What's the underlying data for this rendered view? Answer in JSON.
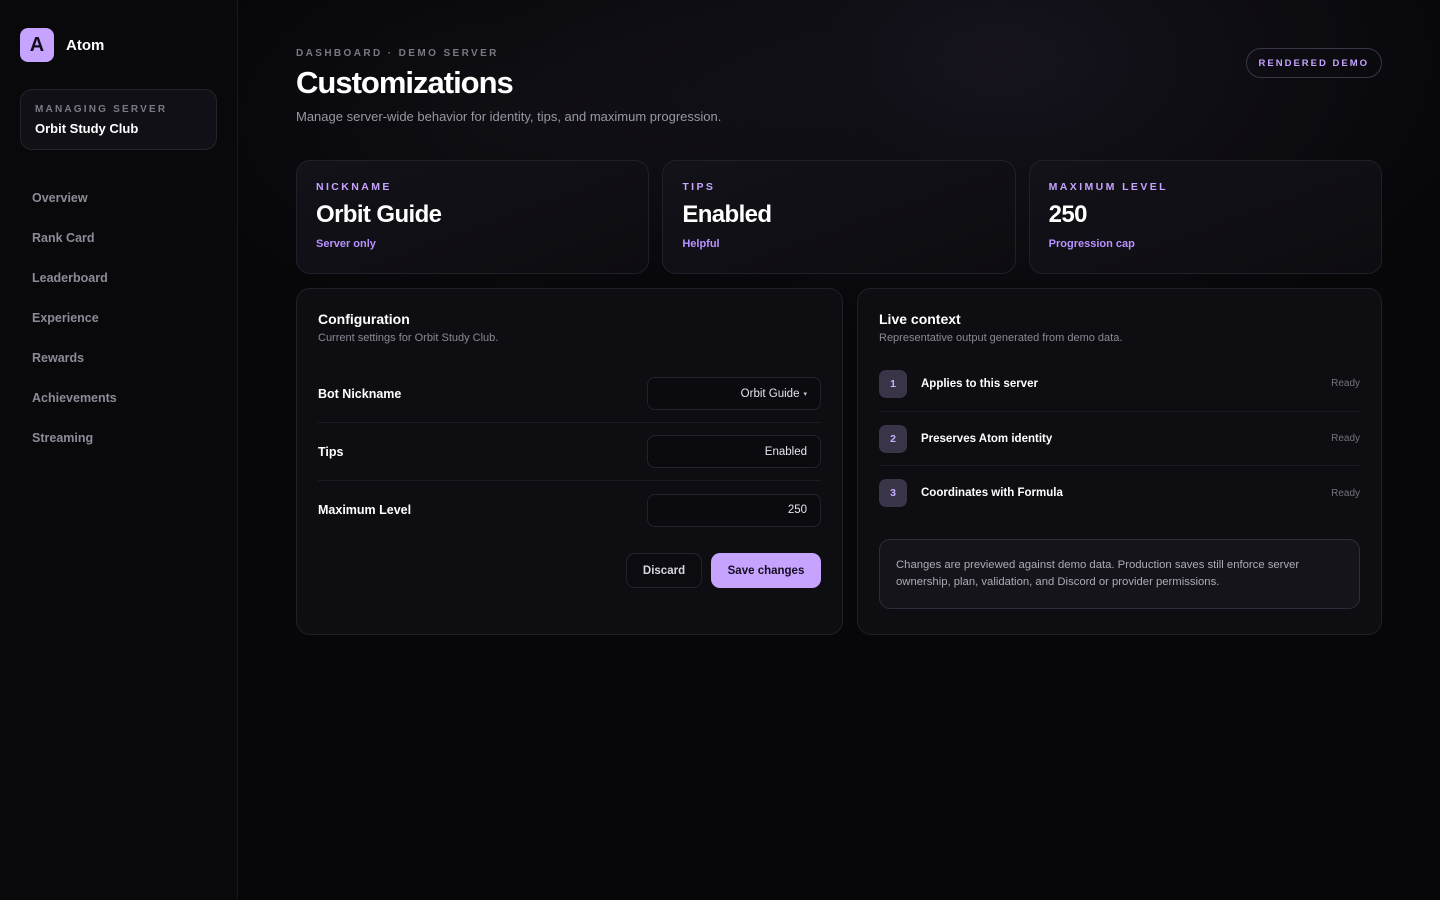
{
  "brand": {
    "logo_letter": "A",
    "name": "Atom"
  },
  "server": {
    "kicker": "MANAGING SERVER",
    "name": "Orbit Study Club"
  },
  "nav": {
    "items": [
      {
        "label": "Overview"
      },
      {
        "label": "Rank Card"
      },
      {
        "label": "Leaderboard"
      },
      {
        "label": "Experience"
      },
      {
        "label": "Rewards"
      },
      {
        "label": "Achievements"
      },
      {
        "label": "Streaming"
      }
    ]
  },
  "header": {
    "breadcrumb": "DASHBOARD · DEMO SERVER",
    "title": "Customizations",
    "subtitle": "Manage server-wide behavior for identity, tips, and maximum progression.",
    "badge": "RENDERED DEMO"
  },
  "stats": [
    {
      "kicker": "NICKNAME",
      "value": "Orbit Guide",
      "note": "Server only"
    },
    {
      "kicker": "TIPS",
      "value": "Enabled",
      "note": "Helpful"
    },
    {
      "kicker": "MAXIMUM LEVEL",
      "value": "250",
      "note": "Progression cap"
    }
  ],
  "config": {
    "title": "Configuration",
    "subtitle": "Current settings for Orbit Study Club.",
    "fields": [
      {
        "label": "Bot Nickname",
        "value": "Orbit Guide",
        "caret": "▾"
      },
      {
        "label": "Tips",
        "value": "Enabled"
      },
      {
        "label": "Maximum Level",
        "value": "250"
      }
    ],
    "discard_label": "Discard",
    "save_label": "Save changes"
  },
  "live": {
    "title": "Live context",
    "subtitle": "Representative output generated from demo data.",
    "items": [
      {
        "num": "1",
        "label": "Applies to this server",
        "status": "Ready"
      },
      {
        "num": "2",
        "label": "Preserves Atom identity",
        "status": "Ready"
      },
      {
        "num": "3",
        "label": "Coordinates with Formula",
        "status": "Ready"
      }
    ],
    "notice": "Changes are previewed against demo data. Production saves still enforce server ownership, plan, validation, and Discord or provider permissions."
  },
  "colors": {
    "accent": "#c6a3ff",
    "background": "#07070a",
    "panel": "#0e0d12"
  }
}
